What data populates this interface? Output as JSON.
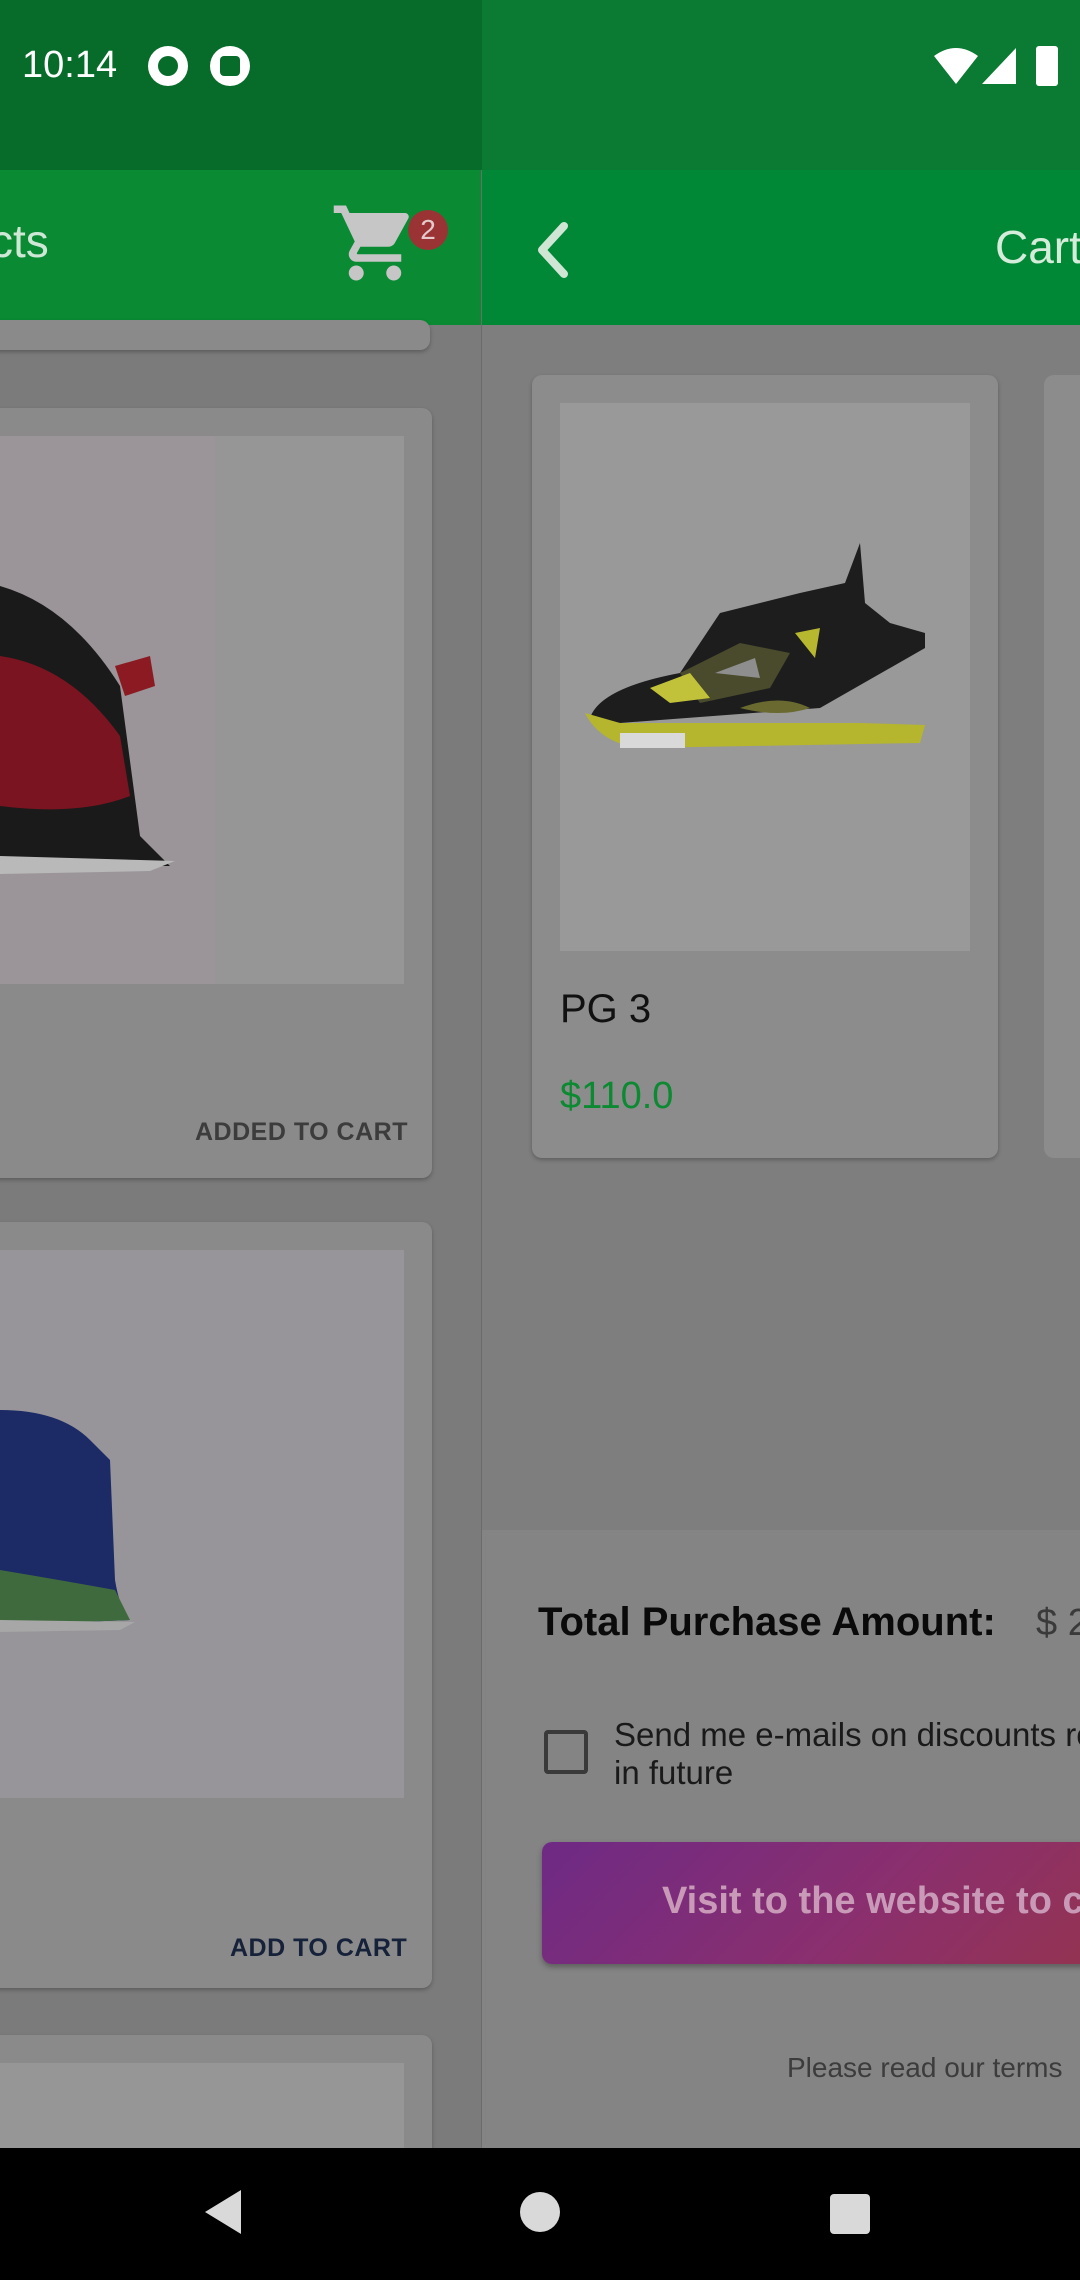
{
  "status_bar": {
    "time": "10:14",
    "icons": [
      "sync-icon",
      "app-icon",
      "wifi-icon",
      "signal-icon",
      "battery-icon"
    ]
  },
  "products_screen": {
    "title_partial": "cts",
    "cart_badge": "2",
    "cards": [
      {
        "button": "ADDED TO CART",
        "button_color": "#3c3c3c"
      },
      {
        "button": "ADD TO CART",
        "button_color": "#16213a"
      }
    ]
  },
  "cart_screen": {
    "title": "Cart",
    "items": [
      {
        "name": "PG 3",
        "price": "$110.0"
      }
    ],
    "total_label": "Total Purchase Amount:",
    "total_value": "$ 2",
    "email_opt_in_line1": "Send me e-mails on discounts re",
    "email_opt_in_line2": "in future",
    "visit_button": "Visit to the website to co",
    "terms": "Please read our terms"
  },
  "colors": {
    "appbar": "#018837",
    "price": "#0b8a32",
    "status_bar": "#0b7a32"
  }
}
